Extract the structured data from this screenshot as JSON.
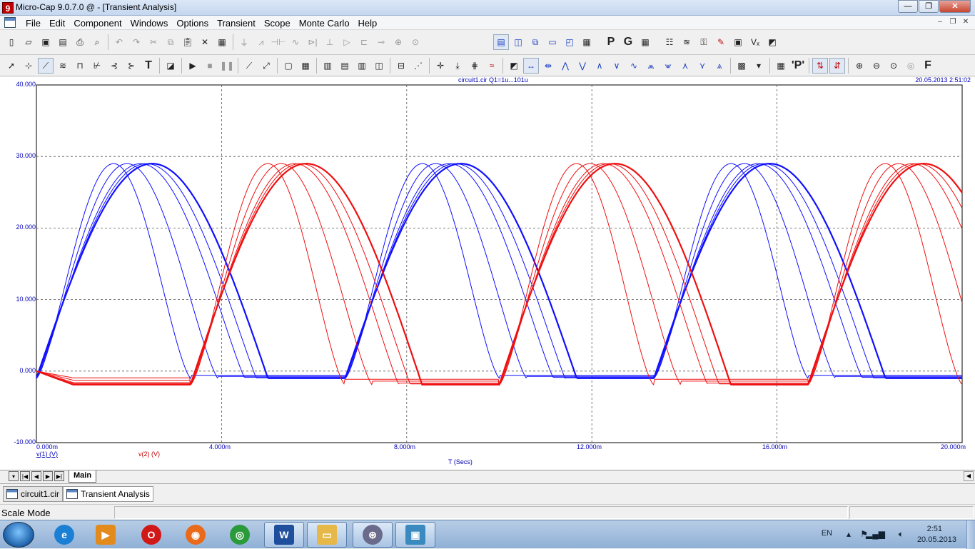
{
  "window": {
    "title": "Micro-Cap 9.0.7.0 @ - [Transient Analysis]",
    "app_icon_glyph": "9",
    "minimize_glyph": "—",
    "restore_glyph": "❐",
    "close_glyph": "✕"
  },
  "menu": {
    "items": [
      "File",
      "Edit",
      "Component",
      "Windows",
      "Options",
      "Transient",
      "Scope",
      "Monte Carlo",
      "Help"
    ],
    "mdi_minimize": "–",
    "mdi_restore": "❐",
    "mdi_close": "✕"
  },
  "toolbar1": {
    "file_icons": [
      "new-file-icon",
      "open-folder-icon",
      "save-icon",
      "save-as-icon",
      "print-icon",
      "print-preview-icon"
    ],
    "edit_icons": [
      "undo-icon",
      "redo-icon",
      "cut-icon",
      "copy-icon",
      "paste-icon",
      "delete-icon",
      "select-all-icon"
    ],
    "component_icons": [
      "ground-icon",
      "resistor-icon",
      "capacitor-icon",
      "inductor-icon",
      "diode-icon",
      "battery-icon",
      "opamp-icon",
      "switch-icon",
      "transistor-icon",
      "node-icon",
      "probe-icon"
    ],
    "window_icons": [
      "tile-horizontal-icon",
      "tile-vertical-icon",
      "cascade-icon",
      "window-icon",
      "window-alt-icon",
      "calculator-icon"
    ],
    "text_buttons": {
      "p": "P",
      "g": "G"
    },
    "tool_icons": [
      "grid-icon",
      "analysis-icon",
      "wave-icon",
      "key-icon",
      "pen-icon",
      "chip-icon",
      "variables-icon",
      "report-icon"
    ]
  },
  "toolbar2": {
    "text_tool": "T",
    "format_letter": "F",
    "p_label": "'P'"
  },
  "chart_data": {
    "type": "line",
    "title": "circuit1.cir Q1=1u...101u",
    "date_stamp": "20.05.2013 2:51:02",
    "xlabel": "T (Secs)",
    "ylabel": "",
    "xlim": [
      0,
      0.02
    ],
    "ylim": [
      -10,
      40
    ],
    "x_ticks": [
      "0.000m",
      "4.000m",
      "8.000m",
      "12.000m",
      "16.000m",
      "20.000m"
    ],
    "y_ticks": [
      "40.000",
      "30.000",
      "20.000",
      "10.000",
      "0.000",
      "-10.000"
    ],
    "grid": true,
    "legend": [
      {
        "name": "v(1) (V)",
        "color": "#0000ff"
      },
      {
        "name": "v(2) (V)",
        "color": "#ff0000"
      }
    ],
    "series": [
      {
        "name": "v(1) (V)",
        "color": "#1010ff",
        "period": 0.00667,
        "peak": 29,
        "trough": -1,
        "start": 0,
        "steps": [
          0,
          0.35,
          0.7,
          0.85,
          1.0
        ]
      },
      {
        "name": "v(2) (V)",
        "color": "#ee1010",
        "period": 0.00667,
        "peak": 29,
        "trough": -1.9,
        "start": 0.00333,
        "steps": [
          0,
          0.35,
          0.7,
          0.85,
          1.0
        ]
      }
    ]
  },
  "sheet_tabs": {
    "nav": [
      "▾",
      "|◀",
      "◀",
      "▶",
      "▶|"
    ],
    "main_tab": "Main",
    "hscroll_right": "◀"
  },
  "doc_tabs": {
    "tab1": "circuit1.cir",
    "tab2": "Transient Analysis"
  },
  "status": {
    "mode": "Scale Mode"
  },
  "taskbar": {
    "apps": [
      {
        "name": "internet-explorer",
        "glyph": "e",
        "color": "#1b7fd3"
      },
      {
        "name": "media-player",
        "glyph": "▶",
        "color": "#e38a1c"
      },
      {
        "name": "opera",
        "glyph": "O",
        "color": "#d01818"
      },
      {
        "name": "firefox",
        "glyph": "◉",
        "color": "#e86a1a"
      },
      {
        "name": "chrome",
        "glyph": "◎",
        "color": "#2a9a3a"
      },
      {
        "name": "word",
        "glyph": "W",
        "color": "#1f4f9c"
      },
      {
        "name": "explorer",
        "glyph": "▭",
        "color": "#e6b847"
      },
      {
        "name": "microcap",
        "glyph": "⊛",
        "color": "#6a6a8a"
      },
      {
        "name": "picture-viewer",
        "glyph": "▣",
        "color": "#3a8ac0"
      }
    ],
    "language": "EN",
    "clock_time": "2:51",
    "clock_date": "20.05.2013"
  }
}
